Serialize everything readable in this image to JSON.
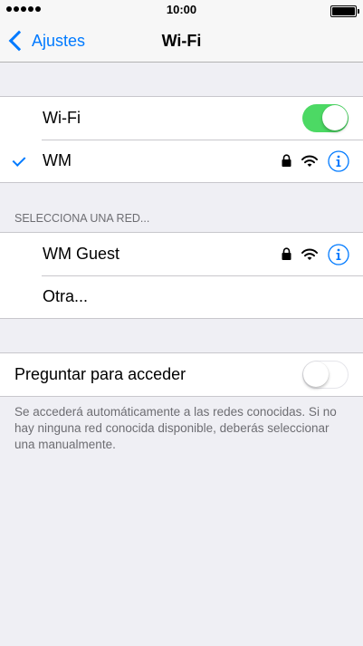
{
  "status_bar": {
    "time": "10:00",
    "signal_bars": 5,
    "battery_level": 1.0
  },
  "nav": {
    "back_label": "Ajustes",
    "title": "Wi-Fi"
  },
  "wifi_group": {
    "wifi_label": "Wi-Fi",
    "wifi_enabled": true,
    "connected_network": "WM"
  },
  "choose_network": {
    "header": "SELECCIONA UNA RED...",
    "networks": [
      {
        "name": "WM Guest",
        "secured": true
      },
      {
        "name": "Otra..."
      }
    ]
  },
  "ask_to_join": {
    "label": "Preguntar para acceder",
    "enabled": false,
    "footer": "Se accederá automáticamente a las redes conocidas. Si no hay ninguna red conocida disponible, deberás seleccionar una manualmente."
  },
  "colors": {
    "accent": "#007aff",
    "toggle_on": "#4cd964",
    "background": "#efeff4"
  },
  "icons": [
    "back-chevron-icon",
    "checkmark-icon",
    "lock-icon",
    "wifi-signal-icon",
    "info-icon",
    "battery-icon",
    "signal-dots-icon"
  ]
}
